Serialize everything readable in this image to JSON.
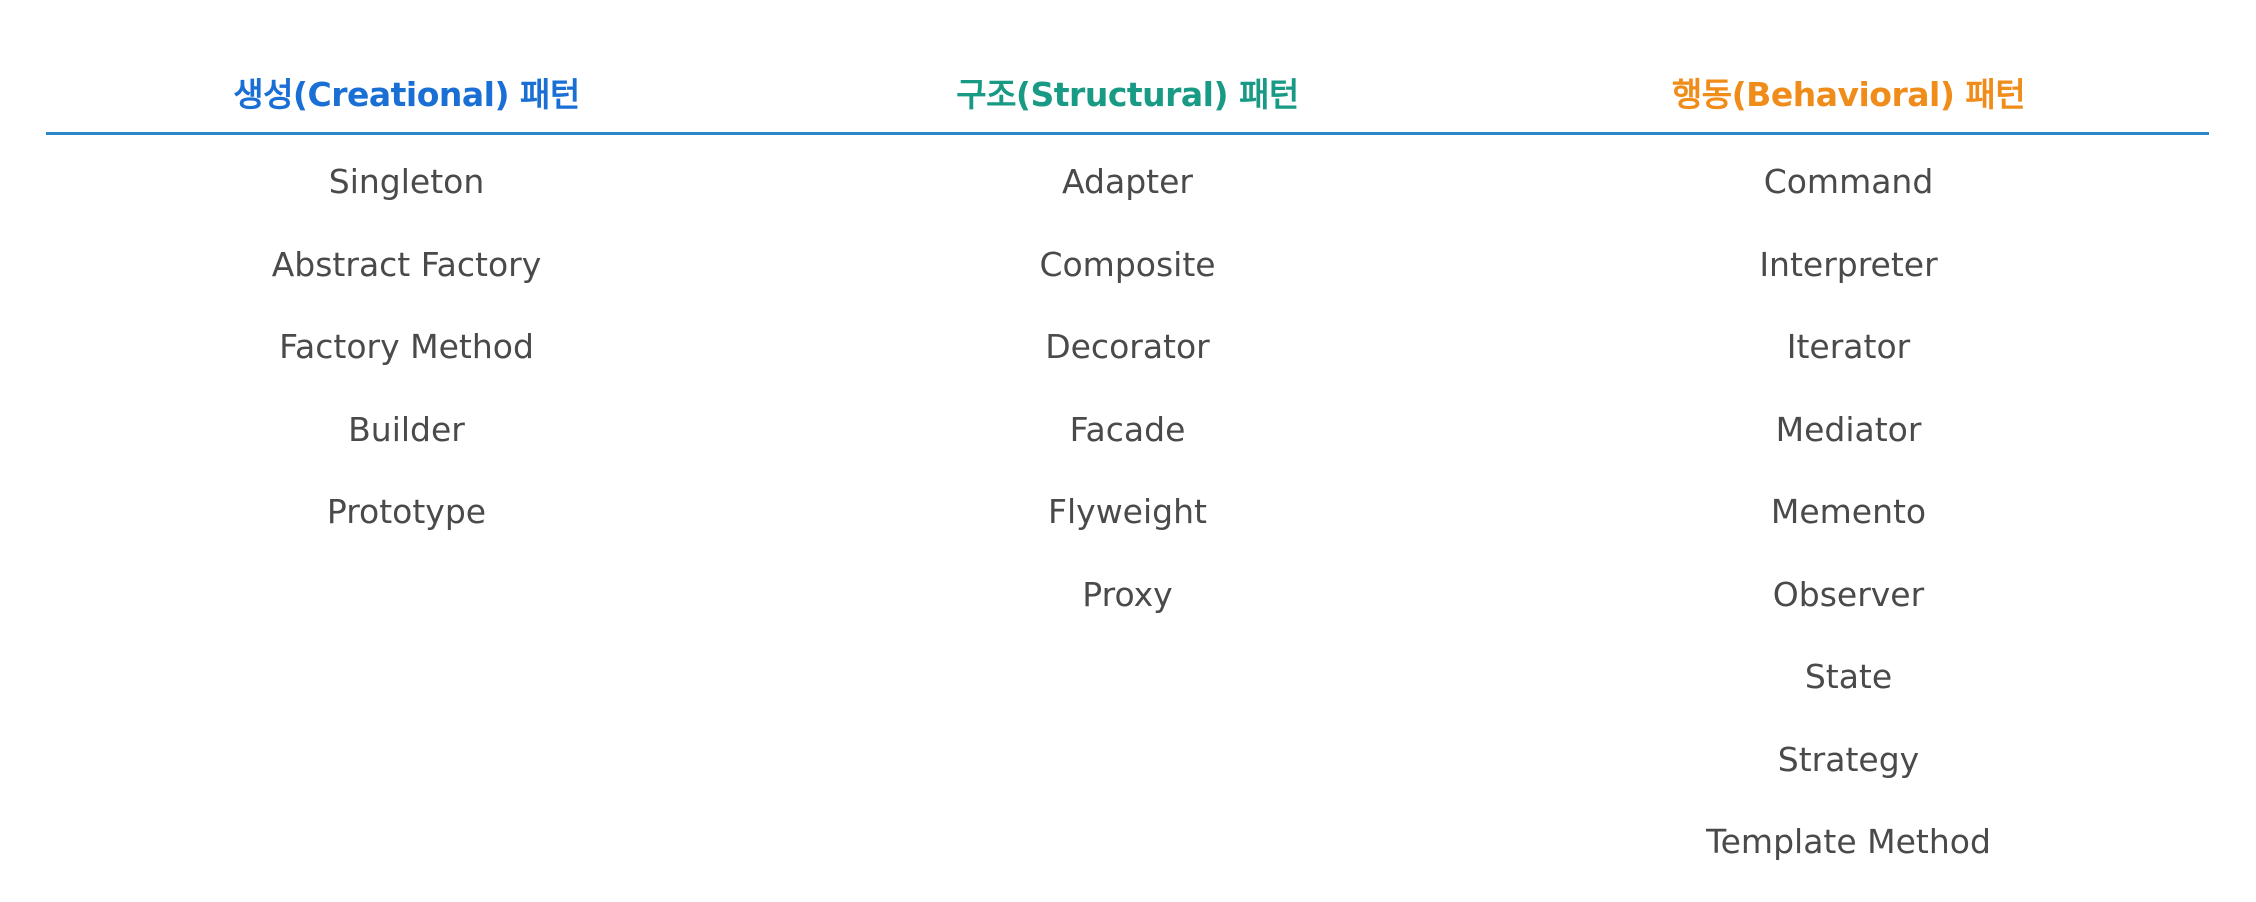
{
  "columns": [
    {
      "header": "생성(Creational) 패턴",
      "color": "#1a6fd4",
      "items": [
        "Singleton",
        "Abstract Factory",
        "Factory Method",
        "Builder",
        "Prototype"
      ]
    },
    {
      "header": "구조(Structural) 패턴",
      "color": "#189a85",
      "items": [
        "Adapter",
        "Composite",
        "Decorator",
        "Facade",
        "Flyweight",
        "Proxy"
      ]
    },
    {
      "header": "행동(Behavioral) 패턴",
      "color": "#f08c1a",
      "items": [
        "Command",
        "Interpreter",
        "Iterator",
        "Mediator",
        "Memento",
        "Observer",
        "State",
        "Strategy",
        "Template Method"
      ]
    }
  ],
  "divider_color": "#2a87c8"
}
